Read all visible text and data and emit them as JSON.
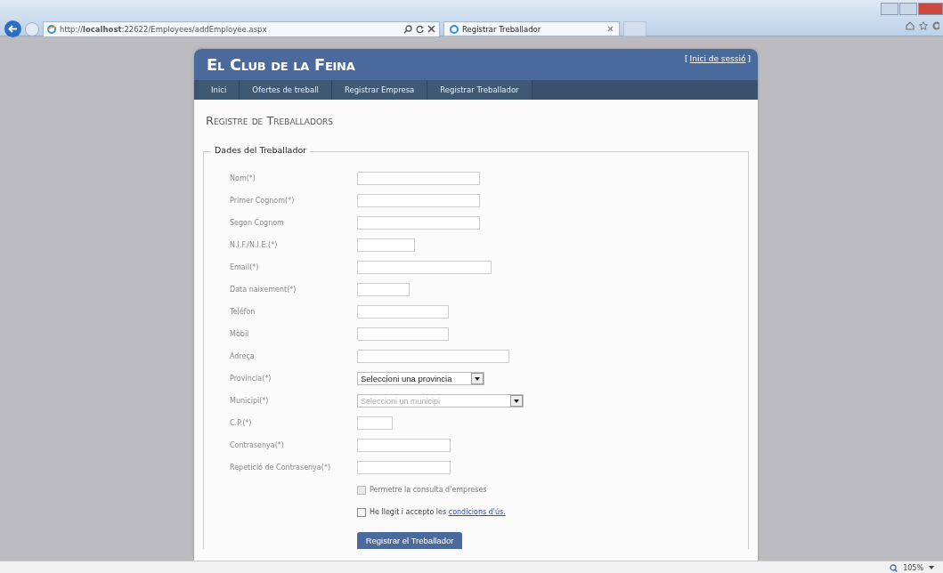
{
  "browser": {
    "url": "http://**localhost**:22622/Employees/addEmployee.aspx",
    "tabs": [
      {
        "label": "Registrar Treballador",
        "selected": true
      }
    ],
    "zoom": "105%"
  },
  "site": {
    "title": "El Club de la Feina",
    "login_link": "Inici de sessió",
    "login_open": "[",
    "login_close": "]",
    "nav": [
      {
        "label": "Inici",
        "selected": false
      },
      {
        "label": "Ofertes de treball",
        "selected": false
      },
      {
        "label": "Registrar Empresa",
        "selected": false
      },
      {
        "label": "Registrar Treballador",
        "selected": false
      }
    ],
    "heading": "Registre de Treballadors",
    "fieldset_legend": "Dades del Treballador",
    "fields": [
      {
        "kind": "text",
        "label": "Nom(*)"
      },
      {
        "kind": "text",
        "label": "Primer Cognom(*)"
      },
      {
        "kind": "text",
        "label": "Segon Cognom"
      },
      {
        "kind": "text",
        "label": "N.I.F./N.I.E.(*)"
      },
      {
        "kind": "text",
        "label": "Email(*)"
      },
      {
        "kind": "text",
        "label": "Data naixement(*)"
      },
      {
        "kind": "text",
        "label": "Teléfon"
      },
      {
        "kind": "text",
        "label": "Mòbil"
      },
      {
        "kind": "text",
        "label": "Adreça"
      },
      {
        "kind": "select",
        "label": "Provincia(*)",
        "value": "Seleccioni una provincia",
        "disabled": false
      },
      {
        "kind": "select",
        "label": "Municipi(*)",
        "value": "Seleccioni un municipi",
        "disabled": true
      },
      {
        "kind": "text",
        "label": "C.P.(*)"
      },
      {
        "kind": "text",
        "label": "Contrasenya(*)"
      },
      {
        "kind": "text",
        "label": "Repetició de Contrasenya(*)"
      }
    ],
    "checkboxes": [
      {
        "text": "Permetre la consulta d'empreses",
        "checked": false,
        "disabled": true
      },
      {
        "text": "He llegit i accepto les ",
        "link": "condicions d'ús.",
        "checked": false,
        "disabled": false
      }
    ],
    "submit": "Registrar el Treballador"
  }
}
